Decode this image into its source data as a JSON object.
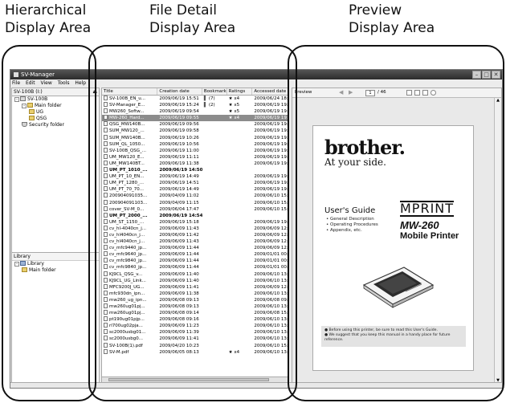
{
  "callouts": {
    "left": [
      "Hierarchical",
      "Display Area"
    ],
    "middle": [
      "File Detail",
      "Display Area"
    ],
    "right": [
      "Preview",
      "Display Area"
    ]
  },
  "window": {
    "title": "SV-Manager",
    "menu": [
      "File",
      "Edit",
      "View",
      "Tools",
      "Help"
    ]
  },
  "tree": {
    "drive": "SV-100B (I:)",
    "items": [
      {
        "label": "SV-100B",
        "kind": "drive",
        "level": 0,
        "toggle": "-"
      },
      {
        "label": "Main folder",
        "kind": "folder",
        "level": 1,
        "toggle": "-"
      },
      {
        "label": "UG",
        "kind": "folder",
        "level": 2,
        "toggle": ""
      },
      {
        "label": "QSG",
        "kind": "folder",
        "level": 2,
        "toggle": ""
      },
      {
        "label": "Security folder",
        "kind": "shield",
        "level": 1,
        "toggle": ""
      }
    ]
  },
  "library": {
    "header": "Library",
    "items": [
      {
        "label": "Library",
        "kind": "lib",
        "level": 0,
        "toggle": "-"
      },
      {
        "label": "Main folder",
        "kind": "folder",
        "level": 1,
        "toggle": ""
      }
    ]
  },
  "file_list": {
    "columns": [
      "Title",
      "Creation date",
      "Bookmark",
      "Ratings",
      "Accessed date"
    ],
    "rows": [
      {
        "title": "SV-100B_EN_u...",
        "created": "2009/06/19 15:51",
        "bookmark": "(7)",
        "rating": "x4",
        "accessed": "2009/06/24 18:"
      },
      {
        "title": "SV-Manager_E...",
        "created": "2009/06/19 15:24",
        "bookmark": "(2)",
        "rating": "x5",
        "accessed": "2009/06/19 19:"
      },
      {
        "title": "MW260_Softw...",
        "created": "2009/06/19 09:54",
        "bookmark": "",
        "rating": "x5",
        "accessed": "2009/06/19 19:"
      },
      {
        "title": "MW-260_Hard...",
        "created": "2009/06/19 09:55",
        "bookmark": "",
        "rating": "x4",
        "accessed": "2009/06/19 19:",
        "selected": true
      },
      {
        "title": "QSG_MW140B...",
        "created": "2009/06/19 09:56",
        "bookmark": "",
        "rating": "",
        "accessed": "2009/06/19 19:"
      },
      {
        "title": "SUM_MW120_...",
        "created": "2009/06/19 09:58",
        "bookmark": "",
        "rating": "",
        "accessed": "2009/06/19 19:"
      },
      {
        "title": "SUM_MW140B...",
        "created": "2009/06/19 10:26",
        "bookmark": "",
        "rating": "",
        "accessed": "2009/06/19 19:"
      },
      {
        "title": "SUM_QL_1050...",
        "created": "2009/06/19 10:56",
        "bookmark": "",
        "rating": "",
        "accessed": "2009/06/19 19:"
      },
      {
        "title": "SV-100B_QSG_...",
        "created": "2009/06/19 11:00",
        "bookmark": "",
        "rating": "",
        "accessed": "2009/06/19 19:"
      },
      {
        "title": "UM_MW120_E...",
        "created": "2009/06/19 11:11",
        "bookmark": "",
        "rating": "",
        "accessed": "2009/06/19 19:"
      },
      {
        "title": "UM_MW140BT...",
        "created": "2009/06/19 11:38",
        "bookmark": "",
        "rating": "",
        "accessed": "2009/06/19 19:"
      },
      {
        "title": "UM_PT_1010_...",
        "created": "2009/06/19 14:50",
        "bookmark": "",
        "rating": "",
        "accessed": "",
        "bold": true
      },
      {
        "title": "UM_PT_10_EN...",
        "created": "2009/06/19 14:49",
        "bookmark": "",
        "rating": "",
        "accessed": "2009/06/19 19:"
      },
      {
        "title": "UM_PT_1280_...",
        "created": "2009/06/19 14:51",
        "bookmark": "",
        "rating": "",
        "accessed": "2009/06/19 19:"
      },
      {
        "title": "UM_PT_70_70...",
        "created": "2009/06/19 14:49",
        "bookmark": "",
        "rating": "",
        "accessed": "2009/06/19 19:"
      },
      {
        "title": "200904091035...",
        "created": "2009/04/09 11:02",
        "bookmark": "",
        "rating": "",
        "accessed": "2009/06/10 15:"
      },
      {
        "title": "200904091103...",
        "created": "2009/04/09 11:15",
        "bookmark": "",
        "rating": "",
        "accessed": "2009/06/10 15:"
      },
      {
        "title": "cover_SV-M_0...",
        "created": "2009/06/04 17:47",
        "bookmark": "",
        "rating": "",
        "accessed": "2009/06/10 15:"
      },
      {
        "title": "UM_PT_2000_...",
        "created": "2009/06/19 14:54",
        "bookmark": "",
        "rating": "",
        "accessed": "",
        "bold": true
      },
      {
        "title": "UM_ST_1150_...",
        "created": "2009/06/19 15:18",
        "bookmark": "",
        "rating": "",
        "accessed": "2009/06/19 19:"
      },
      {
        "title": "cv_hl-4040cn_j...",
        "created": "2009/06/09 11:43",
        "bookmark": "",
        "rating": "",
        "accessed": "2009/06/09 12:"
      },
      {
        "title": "cv_hl4040cn_j...",
        "created": "2009/06/09 11:42",
        "bookmark": "",
        "rating": "",
        "accessed": "2009/06/09 12:"
      },
      {
        "title": "cv_hl4040cn_j...",
        "created": "2009/06/09 11:43",
        "bookmark": "",
        "rating": "",
        "accessed": "2009/06/09 12:"
      },
      {
        "title": "cv_mfc9440_jp...",
        "created": "2009/06/09 11:44",
        "bookmark": "",
        "rating": "",
        "accessed": "2009/06/09 12:"
      },
      {
        "title": "cv_mfc9640_jp...",
        "created": "2009/06/09 11:44",
        "bookmark": "",
        "rating": "",
        "accessed": "2009/01/01 00:"
      },
      {
        "title": "cv_mfc9840_jp...",
        "created": "2009/06/09 11:44",
        "bookmark": "",
        "rating": "",
        "accessed": "2009/01/01 00:"
      },
      {
        "title": "cv_mfc9840_jp...",
        "created": "2009/06/09 11:44",
        "bookmark": "",
        "rating": "",
        "accessed": "2009/01/01 00:"
      },
      {
        "title": "KJ9CL_QSG_v...",
        "created": "2009/06/09 11:40",
        "bookmark": "",
        "rating": "",
        "accessed": "2009/06/10 13:"
      },
      {
        "title": "KJ9CL_UG_Link...",
        "created": "2009/06/09 11:40",
        "bookmark": "",
        "rating": "",
        "accessed": "2009/06/10 13:"
      },
      {
        "title": "MFC9200J_UG...",
        "created": "2009/06/09 11:41",
        "bookmark": "",
        "rating": "",
        "accessed": "2009/06/09 12:"
      },
      {
        "title": "mfc930dn_ipn...",
        "created": "2009/06/09 11:38",
        "bookmark": "",
        "rating": "",
        "accessed": "2009/06/10 13:"
      },
      {
        "title": "mw260_ug_ipn...",
        "created": "2009/06/08 09:13",
        "bookmark": "",
        "rating": "",
        "accessed": "2009/06/08 09:"
      },
      {
        "title": "mw260ug01pj...",
        "created": "2009/06/08 09:13",
        "bookmark": "",
        "rating": "",
        "accessed": "2009/06/10 13:"
      },
      {
        "title": "mw260ug01pj...",
        "created": "2009/06/08 09:14",
        "bookmark": "",
        "rating": "",
        "accessed": "2009/06/08 15:"
      },
      {
        "title": "pt190ug01pjp...",
        "created": "2009/06/08 09:16",
        "bookmark": "",
        "rating": "",
        "accessed": "2009/06/10 13:"
      },
      {
        "title": "rl700ug02pja...",
        "created": "2009/06/09 11:23",
        "bookmark": "",
        "rating": "",
        "accessed": "2009/06/10 13:"
      },
      {
        "title": "sc2000usbg01...",
        "created": "2009/06/09 11:39",
        "bookmark": "",
        "rating": "",
        "accessed": "2009/06/10 13:"
      },
      {
        "title": "sc2000usbg0...",
        "created": "2009/06/09 11:41",
        "bookmark": "",
        "rating": "",
        "accessed": "2009/06/10 13:"
      },
      {
        "title": "SV-100B(1).pdf",
        "created": "2009/04/20 10:23",
        "bookmark": "",
        "rating": "",
        "accessed": "2009/06/10 15:"
      },
      {
        "title": "SV-M.pdf",
        "created": "2009/06/05 08:13",
        "bookmark": "",
        "rating": "x4",
        "accessed": "2009/06/10 13:"
      }
    ]
  },
  "preview": {
    "label": "Preview",
    "page_current": "1",
    "page_total": "/ 46",
    "brand": "brother.",
    "tagline": "At your side.",
    "guide_title": "User's Guide",
    "guide_bullets": [
      "• General Description",
      "• Operating Procedures",
      "• Appendix, etc."
    ],
    "series": "MPRINT",
    "model": "MW-260",
    "product": "Mobile Printer",
    "notes": [
      "● Before using this printer, be sure to read this User's Guide.",
      "● We suggest that you keep this manual in a handy place for future reference."
    ]
  }
}
